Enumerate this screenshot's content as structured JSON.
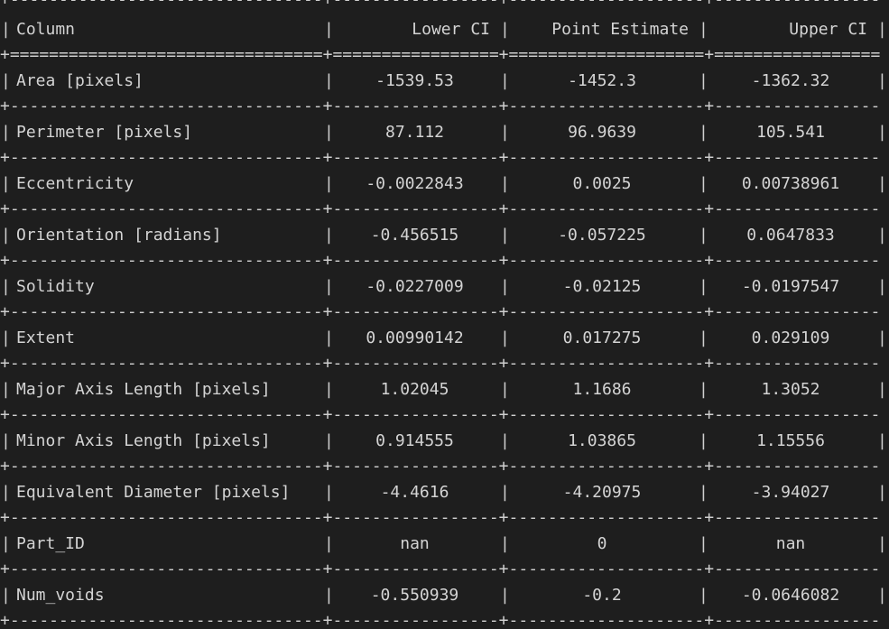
{
  "table": {
    "headers": [
      "Column",
      "Lower CI",
      "Point Estimate",
      "Upper CI"
    ],
    "rows": [
      [
        "Area [pixels]",
        "-1539.53",
        "-1452.3",
        "-1362.32"
      ],
      [
        "Perimeter [pixels]",
        "87.112",
        "96.9639",
        "105.541"
      ],
      [
        "Eccentricity",
        "-0.0022843",
        "0.0025",
        "0.00738961"
      ],
      [
        "Orientation [radians]",
        "-0.456515",
        "-0.057225",
        "0.0647833"
      ],
      [
        "Solidity",
        "-0.0227009",
        "-0.02125",
        "-0.0197547"
      ],
      [
        "Extent",
        "0.00990142",
        "0.017275",
        "0.029109"
      ],
      [
        "Major Axis Length [pixels]",
        "1.02045",
        "1.1686",
        "1.3052"
      ],
      [
        "Minor Axis Length [pixels]",
        "0.914555",
        "1.03865",
        "1.15556"
      ],
      [
        "Equivalent Diameter [pixels]",
        "-4.4616",
        "-4.20975",
        "-3.94027"
      ],
      [
        "Part_ID",
        "nan",
        "0",
        "nan"
      ],
      [
        "Num_voids",
        "-0.550939",
        "-0.2",
        "-0.0646082"
      ]
    ]
  },
  "colors": {
    "background": "#1e1e1e",
    "text": "#d4d4d4"
  }
}
